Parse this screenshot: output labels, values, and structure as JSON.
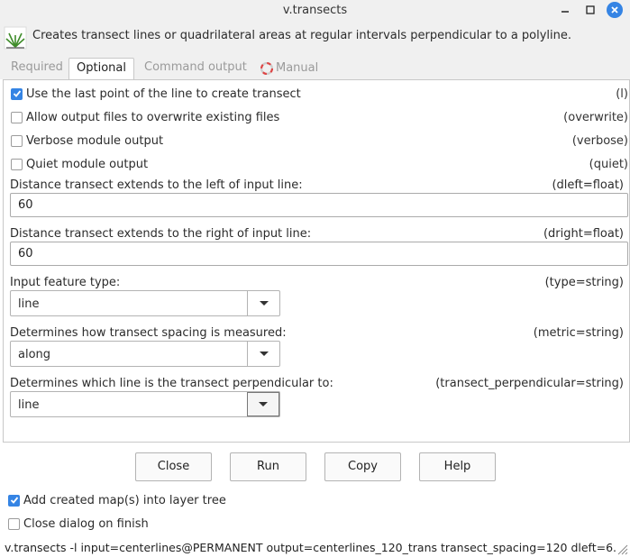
{
  "window": {
    "title": "v.transects",
    "description": "Creates transect lines or quadrilateral areas at regular intervals perpendicular to a polyline."
  },
  "tabs": [
    {
      "label": "Required"
    },
    {
      "label": "Optional"
    },
    {
      "label": "Command output"
    },
    {
      "label": "Manual"
    }
  ],
  "checkboxes": [
    {
      "label": "Use the last point of the line to create transect",
      "tag": "(l)",
      "checked": true
    },
    {
      "label": "Allow output files to overwrite existing files",
      "tag": "(overwrite)",
      "checked": false
    },
    {
      "label": "Verbose module output",
      "tag": "(verbose)",
      "checked": false
    },
    {
      "label": "Quiet module output",
      "tag": "(quiet)",
      "checked": false
    }
  ],
  "fields": {
    "dleft": {
      "label": "Distance transect extends to the left of input line:",
      "tag": "(dleft=float)",
      "value": "60"
    },
    "dright": {
      "label": "Distance transect extends to the right of input line:",
      "tag": "(dright=float)",
      "value": "60"
    },
    "type": {
      "label": "Input feature type:",
      "tag": "(type=string)",
      "value": "line"
    },
    "metric": {
      "label": "Determines how transect spacing is measured:",
      "tag": "(metric=string)",
      "value": "along"
    },
    "transect_perpendicular": {
      "label": "Determines which line is the transect perpendicular to:",
      "tag": "(transect_perpendicular=string)",
      "value": "line"
    }
  },
  "buttons": {
    "close": "Close",
    "run": "Run",
    "copy": "Copy",
    "help": "Help"
  },
  "footer": {
    "add_to_layer_tree": {
      "label": "Add created map(s) into layer tree",
      "checked": true
    },
    "close_on_finish": {
      "label": "Close dialog on finish",
      "checked": false
    },
    "command": "v.transects -l input=centerlines@PERMANENT output=centerlines_120_trans transect_spacing=120 dleft=6..."
  },
  "colors": {
    "accent": "#3584e4",
    "window_bg": "#f0f0f0"
  },
  "icons": [
    "grass-logo-icon",
    "minimize-icon",
    "maximize-icon",
    "close-icon",
    "checkmark-icon",
    "chevron-down-icon",
    "lifebuoy-icon",
    "resize-grip-icon"
  ]
}
